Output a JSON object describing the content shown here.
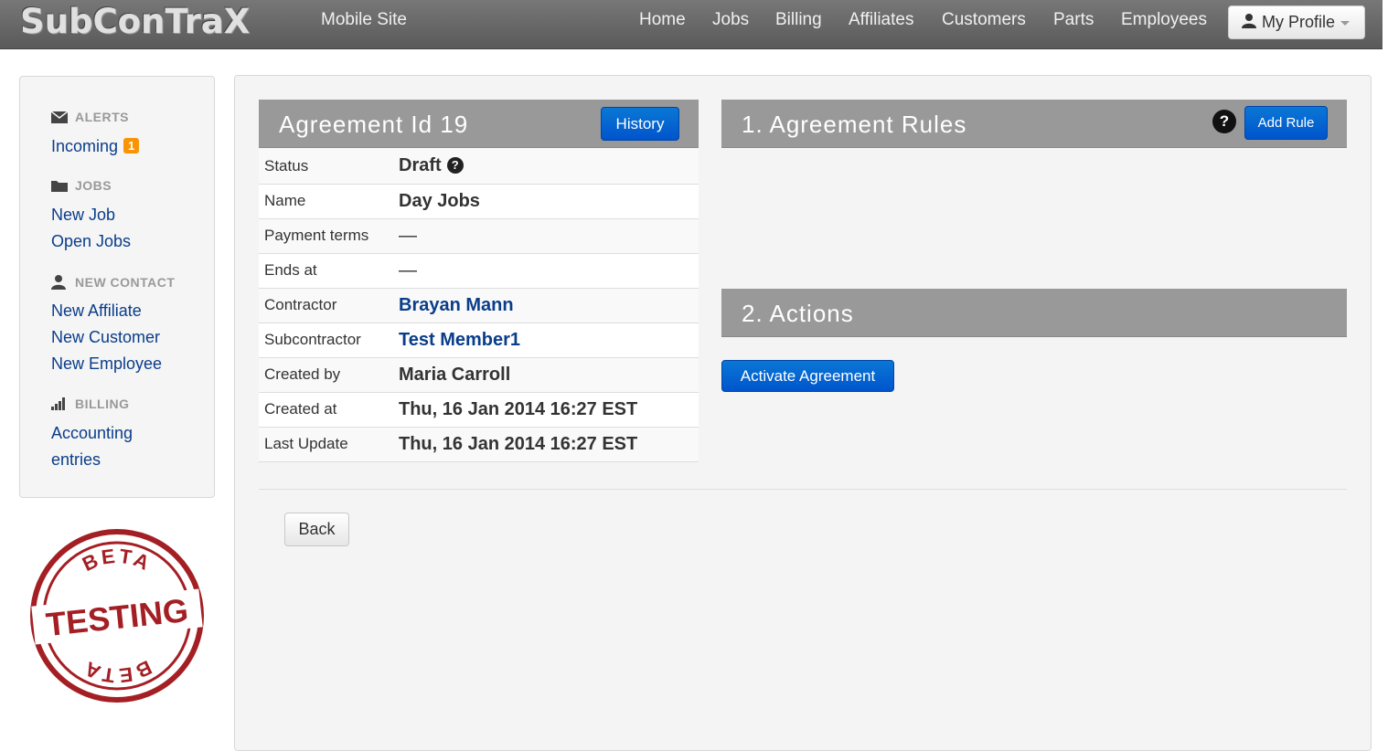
{
  "navbar": {
    "brand": "SubConTraX",
    "mobile_site": "Mobile Site",
    "links": [
      "Home",
      "Jobs",
      "Billing",
      "Affiliates",
      "Customers",
      "Parts",
      "Employees"
    ],
    "profile": "My Profile"
  },
  "sidebar": {
    "alerts_heading": "ALERTS",
    "incoming": "Incoming",
    "incoming_count": "1",
    "jobs_heading": "JOBS",
    "new_job": "New Job",
    "open_jobs": "Open Jobs",
    "contact_heading": "NEW CONTACT",
    "new_affiliate": "New Affiliate",
    "new_customer": "New Customer",
    "new_employee": "New Employee",
    "billing_heading": "BILLING",
    "accounting_1": "Accounting",
    "accounting_2": "entries"
  },
  "stamp": {
    "top": "BETA",
    "middle": "TESTING",
    "bottom": "BETA"
  },
  "agreement": {
    "title": "Agreement Id 19",
    "history_button": "History",
    "rows": [
      {
        "label": "Status",
        "value": "Draft"
      },
      {
        "label": "Name",
        "value": "Day Jobs"
      },
      {
        "label": "Payment terms",
        "value": "—"
      },
      {
        "label": "Ends at",
        "value": "—"
      },
      {
        "label": "Contractor",
        "value": "Brayan Mann"
      },
      {
        "label": "Subcontractor",
        "value": "Test Member1"
      },
      {
        "label": "Created by",
        "value": "Maria Carroll"
      },
      {
        "label": "Created at",
        "value": "Thu, 16 Jan 2014 16:27 EST"
      },
      {
        "label": "Last Update",
        "value": "Thu, 16 Jan 2014 16:27 EST"
      }
    ]
  },
  "rules": {
    "title": "1. Agreement Rules",
    "add_rule": "Add Rule",
    "help": "?"
  },
  "actions": {
    "title": "2. Actions",
    "activate": "Activate Agreement"
  },
  "back_button": "Back"
}
